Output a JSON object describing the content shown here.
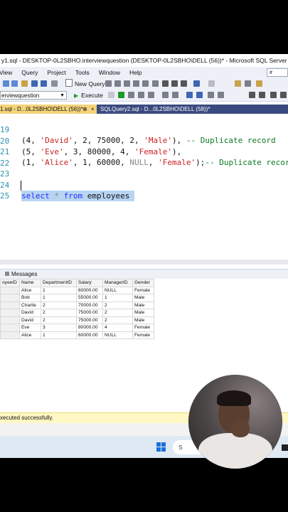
{
  "window": {
    "title": "y1.sql - DESKTOP-0L2SBHO.interviewquestion (DESKTOP-0L2SBHO\\DELL (56))* - Microsoft SQL Server Management"
  },
  "menu": [
    "View",
    "Query",
    "Project",
    "Tools",
    "Window",
    "Help"
  ],
  "toolbar": {
    "new_query": "New Query",
    "database": "erviewquestion",
    "execute": "Execute",
    "quick_launch": "#"
  },
  "tabs": [
    {
      "label": "1.sql - D...0L2SBHO\\DELL (56))*",
      "pin": "⊕",
      "close": "×"
    },
    {
      "label": "SQLQuery2.sql - D...0L2SBHO\\DELL (58))*"
    }
  ],
  "editor": {
    "lines": [
      {
        "num": "19",
        "pre": "(4, ",
        "s1": "'David'",
        "mid": ", 2, 75000, 2, ",
        "s2": "'Male'",
        "post": "), ",
        "comment": "-- Duplicate record"
      },
      {
        "num": "20",
        "pre": "(5, ",
        "s1": "'Eve'",
        "mid": ", 3, 80000, 4, ",
        "s2": "'Female'",
        "post": "),",
        "comment": ""
      },
      {
        "num": "21",
        "pre": "(1, ",
        "s1": "'Alice'",
        "mid": ", 1, 60000, ",
        "null": "NULL",
        "mid2": ", ",
        "s2": "'Female'",
        "post": ");",
        "comment": "-- Duplicate recor"
      },
      {
        "num": "22"
      },
      {
        "num": "23"
      },
      {
        "num": "24",
        "kw1": "select",
        "star": " * ",
        "kw2": "from",
        "ident": " employees"
      },
      {
        "num": "25"
      }
    ]
  },
  "results": {
    "tab_messages": "Messages",
    "columns": [
      "oyeeID",
      "Name",
      "DepartmentID",
      "Salary",
      "ManagerID",
      "Gender"
    ],
    "rows": [
      [
        "",
        "Alice",
        "1",
        "60000.00",
        "NULL",
        "Female"
      ],
      [
        "",
        "Bob",
        "1",
        "55000.00",
        "1",
        "Male"
      ],
      [
        "",
        "Charlie",
        "2",
        "70000.00",
        "2",
        "Male"
      ],
      [
        "",
        "David",
        "2",
        "75000.00",
        "2",
        "Male"
      ],
      [
        "",
        "David",
        "2",
        "75000.00",
        "2",
        "Male"
      ],
      [
        "",
        "Eve",
        "3",
        "80000.00",
        "4",
        "Female"
      ],
      [
        "",
        "Alice",
        "1",
        "60000.00",
        "NULL",
        "Female"
      ]
    ]
  },
  "status": {
    "message": "xecuted successfully."
  },
  "taskbar": {
    "search_label": "S"
  },
  "colors": {
    "tab_active": "#f4d37a",
    "tab_bar": "#3a4a80",
    "status_bg": "#fff8c4",
    "string": "#cc2222",
    "comment": "#0a7a20",
    "keyword": "#1f2fff"
  }
}
